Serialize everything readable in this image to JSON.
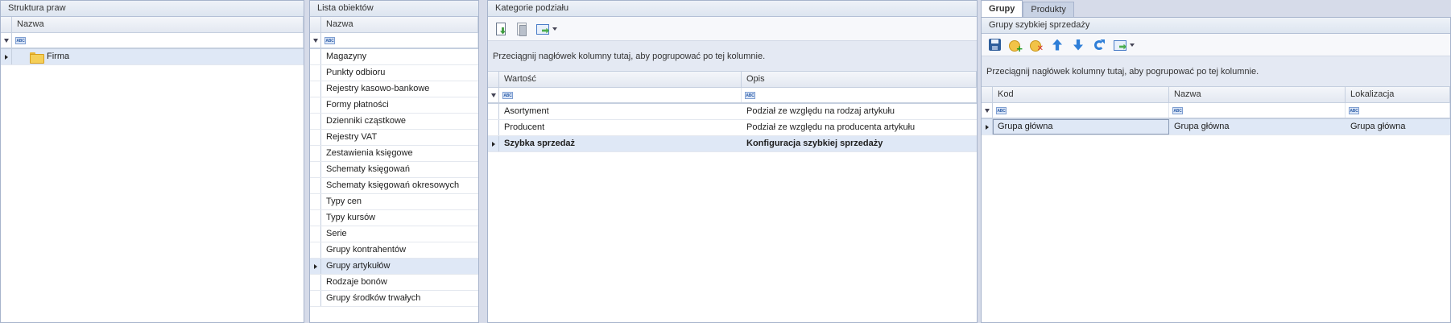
{
  "struktura": {
    "title": "Struktura praw",
    "column": "Nazwa",
    "rows": [
      {
        "label": "Firma"
      }
    ]
  },
  "lista": {
    "title": "Lista obiektów",
    "column": "Nazwa",
    "items": [
      "Magazyny",
      "Punkty odbioru",
      "Rejestry kasowo-bankowe",
      "Formy płatności",
      "Dzienniki cząstkowe",
      "Rejestry VAT",
      "Zestawienia księgowe",
      "Schematy księgowań",
      "Schematy księgowań okresowych",
      "Typy cen",
      "Typy kursów",
      "Serie",
      "Grupy kontrahentów",
      "Grupy artykułów",
      "Rodzaje bonów",
      "Grupy środków trwałych"
    ],
    "selected_index": 13
  },
  "kategorie": {
    "title": "Kategorie podziału",
    "group_hint": "Przeciągnij nagłówek kolumny tutaj, aby pogrupować po tej kolumnie.",
    "columns": {
      "wartosc": "Wartość",
      "opis": "Opis"
    },
    "rows": [
      {
        "wartosc": "Asortyment",
        "opis": "Podział ze względu na rodzaj artykułu"
      },
      {
        "wartosc": "Producent",
        "opis": "Podział ze względu na producenta artykułu"
      },
      {
        "wartosc": "Szybka sprzedaż",
        "opis": "Konfiguracja szybkiej sprzedaży"
      }
    ]
  },
  "tabs": {
    "grupy": "Grupy",
    "produkty": "Produkty"
  },
  "grupy": {
    "title": "Grupy szybkiej sprzedaży",
    "group_hint": "Przeciągnij nagłówek kolumny tutaj, aby pogrupować po tej kolumnie.",
    "columns": {
      "kod": "Kod",
      "nazwa": "Nazwa",
      "lokalizacja": "Lokalizacja"
    },
    "rows": [
      {
        "kod": "Grupa główna",
        "nazwa": "Grupa główna",
        "lokalizacja": "Grupa główna"
      }
    ]
  },
  "filter_icon_text": "ABC",
  "icons": {
    "folder": "folder-icon",
    "filter": "filter-icon",
    "row_indicator": "row-indicator-icon"
  }
}
